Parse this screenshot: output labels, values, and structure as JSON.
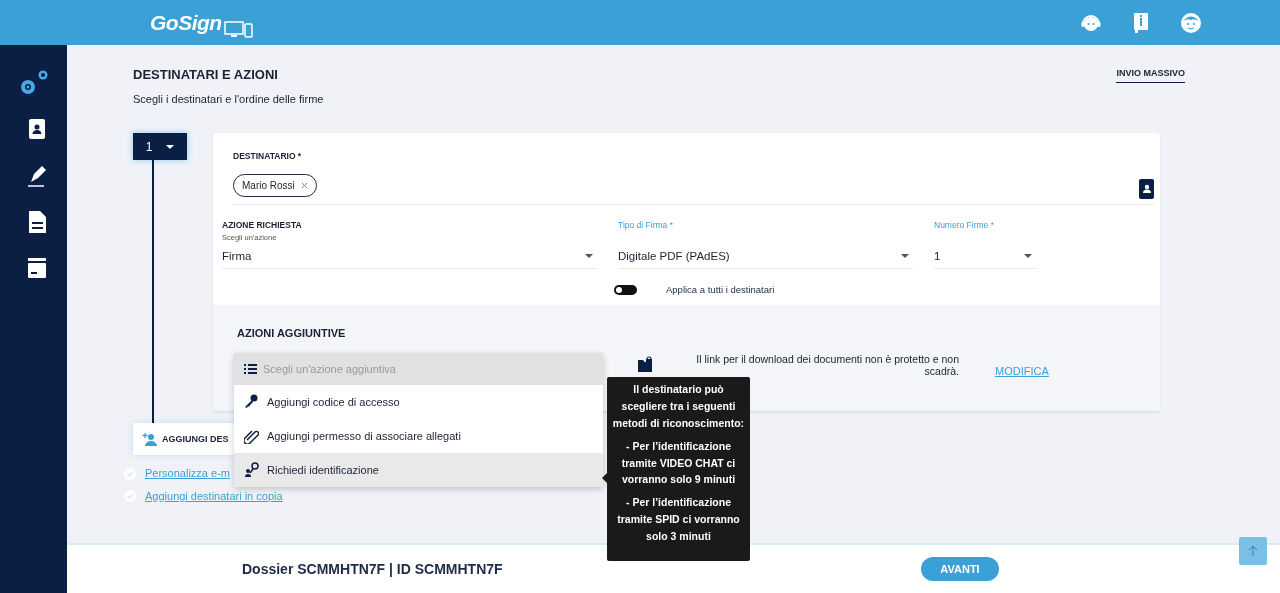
{
  "header": {
    "logo": "GoSign"
  },
  "sidebar": {
    "items": [
      {
        "kind": "settings",
        "selected": true
      },
      {
        "kind": "contacts",
        "selected": false
      },
      {
        "kind": "sign",
        "selected": false
      },
      {
        "kind": "document",
        "selected": false
      },
      {
        "kind": "archive",
        "selected": false
      }
    ]
  },
  "page": {
    "title": "DESTINATARI E AZIONI",
    "subtitle": "Scegli i destinatari e l'ordine delle firme",
    "bulk_link": "INVIO MASSIVO"
  },
  "recipient": {
    "step": "1",
    "label": "DESTINATARIO *",
    "chips": [
      "Mario Rossi"
    ],
    "action": {
      "label": "AZIONE RICHIESTA",
      "hint": "Scegli un'azione",
      "value": "Firma"
    },
    "signature_type": {
      "label": "Tipo di Firma *",
      "value": "Digitale PDF (PAdES)"
    },
    "signature_count": {
      "label": "Numero Firme *",
      "value": "1"
    },
    "apply_all": {
      "label": "Applica a tutti i destinatari",
      "on": false
    }
  },
  "additional": {
    "title": "AZIONI AGGIUNTIVE",
    "dropdown": {
      "placeholder": "Scegli un'azione aggiuntiva",
      "options": [
        {
          "kind": "key",
          "label": "Aggiungi codice di accesso",
          "highlighted": false
        },
        {
          "kind": "attachment",
          "label": "Aggiungi permesso di associare allegati",
          "highlighted": false
        },
        {
          "kind": "identity",
          "label": "Richiedi identificazione",
          "highlighted": true
        }
      ]
    },
    "notice": "Il link per il download dei documenti non è protetto e non scadrà.",
    "link": "MODIFICA"
  },
  "tooltip": [
    "Il destinatario può scegliere tra i seguenti metodi di riconoscimento:",
    "- Per l’identificazione tramite VIDEO CHAT ci vorranno solo 9 minuti",
    "- Per l’identificazione tramite SPID ci vorranno solo 3 minuti"
  ],
  "add_recipient": "AGGIUNGI DES",
  "options": [
    {
      "label": "Personalizza e-m",
      "checked": false
    },
    {
      "label": "Aggiungi destinatari in copia",
      "checked": false
    }
  ],
  "footer": {
    "dossier": "Dossier SCMMHTN7F | ID SCMMHTN7F",
    "next": "AVANTI"
  }
}
